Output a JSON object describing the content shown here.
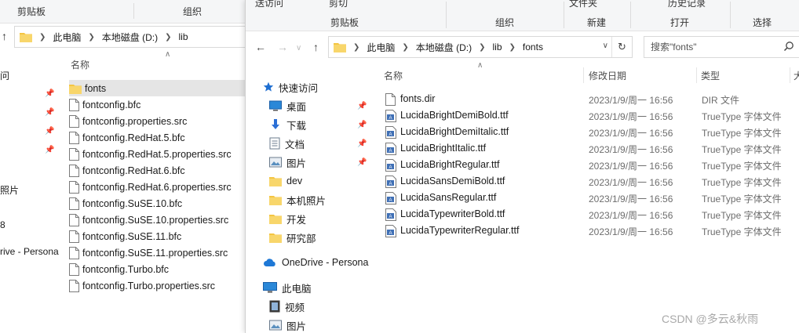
{
  "back_window": {
    "ribbon": {
      "clipboard": "剪贴板",
      "organize": "组织"
    },
    "breadcrumb": [
      "此电脑",
      "本地磁盘 (D:)",
      "lib"
    ],
    "column_name": "名称",
    "nav_fragments": [
      "问",
      "照片",
      "8",
      "rive - Persona"
    ],
    "files": [
      {
        "name": "fonts",
        "kind": "folder",
        "selected": true
      },
      {
        "name": "fontconfig.bfc",
        "kind": "file"
      },
      {
        "name": "fontconfig.properties.src",
        "kind": "file"
      },
      {
        "name": "fontconfig.RedHat.5.bfc",
        "kind": "file"
      },
      {
        "name": "fontconfig.RedHat.5.properties.src",
        "kind": "file"
      },
      {
        "name": "fontconfig.RedHat.6.bfc",
        "kind": "file"
      },
      {
        "name": "fontconfig.RedHat.6.properties.src",
        "kind": "file"
      },
      {
        "name": "fontconfig.SuSE.10.bfc",
        "kind": "file"
      },
      {
        "name": "fontconfig.SuSE.10.properties.src",
        "kind": "file"
      },
      {
        "name": "fontconfig.SuSE.11.bfc",
        "kind": "file"
      },
      {
        "name": "fontconfig.SuSE.11.properties.src",
        "kind": "file"
      },
      {
        "name": "fontconfig.Turbo.bfc",
        "kind": "file"
      },
      {
        "name": "fontconfig.Turbo.properties.src",
        "kind": "file"
      }
    ]
  },
  "front_window": {
    "ribbon": {
      "clipboard": "剪贴板",
      "organize": "组织",
      "new": "新建",
      "open": "打开",
      "select": "选择",
      "quick_access_fragment": "送访问",
      "cut_fragment": "剪切",
      "file_fragment": "文件夹",
      "history_fragment": "历史记录"
    },
    "breadcrumb": [
      "此电脑",
      "本地磁盘 (D:)",
      "lib",
      "fonts"
    ],
    "search_placeholder": "搜索\"fonts\"",
    "columns": {
      "name": "名称",
      "date": "修改日期",
      "type": "类型",
      "size_fragment": "大"
    },
    "nav": {
      "quick_access": "快速访问",
      "desktop": "桌面",
      "downloads": "下载",
      "documents": "文档",
      "pictures": "图片",
      "dev": "dev",
      "camera_roll": "本机照片",
      "develop": "开发",
      "research": "研究部",
      "onedrive": "OneDrive - Persona",
      "this_pc": "此电脑",
      "videos": "视频",
      "pictures2": "图片"
    },
    "files": [
      {
        "name": "fonts.dir",
        "date": "2023/1/9/周一 16:56",
        "type": "DIR 文件",
        "kind": "file"
      },
      {
        "name": "LucidaBrightDemiBold.ttf",
        "date": "2023/1/9/周一 16:56",
        "type": "TrueType 字体文件",
        "kind": "font"
      },
      {
        "name": "LucidaBrightDemiItalic.ttf",
        "date": "2023/1/9/周一 16:56",
        "type": "TrueType 字体文件",
        "kind": "font"
      },
      {
        "name": "LucidaBrightItalic.ttf",
        "date": "2023/1/9/周一 16:56",
        "type": "TrueType 字体文件",
        "kind": "font"
      },
      {
        "name": "LucidaBrightRegular.ttf",
        "date": "2023/1/9/周一 16:56",
        "type": "TrueType 字体文件",
        "kind": "font"
      },
      {
        "name": "LucidaSansDemiBold.ttf",
        "date": "2023/1/9/周一 16:56",
        "type": "TrueType 字体文件",
        "kind": "font"
      },
      {
        "name": "LucidaSansRegular.ttf",
        "date": "2023/1/9/周一 16:56",
        "type": "TrueType 字体文件",
        "kind": "font"
      },
      {
        "name": "LucidaTypewriterBold.ttf",
        "date": "2023/1/9/周一 16:56",
        "type": "TrueType 字体文件",
        "kind": "font"
      },
      {
        "name": "LucidaTypewriterRegular.ttf",
        "date": "2023/1/9/周一 16:56",
        "type": "TrueType 字体文件",
        "kind": "font"
      }
    ]
  },
  "watermark": "CSDN @多云&秋雨",
  "colors": {
    "folder": "#f4c542",
    "quick_access_star": "#1f6fd1",
    "onedrive": "#1e78d6",
    "selection": "#e5e5e5"
  },
  "icons": [
    "folder-icon",
    "file-icon",
    "font-file-icon",
    "star-icon",
    "pin-icon",
    "desktop-icon",
    "download-icon",
    "document-icon",
    "picture-icon",
    "cloud-icon",
    "computer-icon",
    "video-icon",
    "search-icon",
    "refresh-icon",
    "back-arrow-icon",
    "forward-arrow-icon",
    "up-arrow-icon"
  ]
}
